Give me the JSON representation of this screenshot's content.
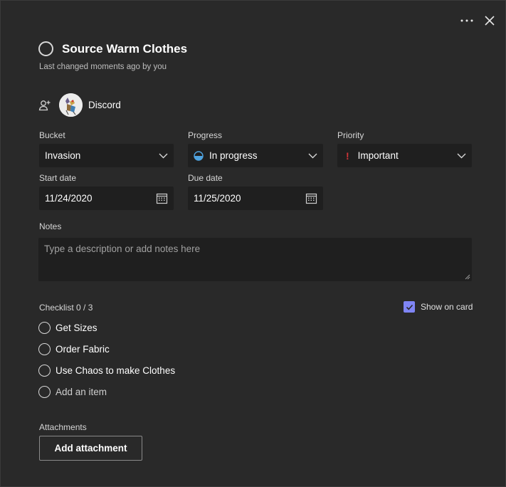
{
  "header": {
    "more_icon": "ellipsis-icon",
    "close_icon": "close-icon"
  },
  "task": {
    "title": "Source Warm Clothes",
    "last_changed": "Last changed moments ago by you"
  },
  "assignment": {
    "icon": "assign-person-icon",
    "assignee_name": "Discord"
  },
  "fields": {
    "bucket": {
      "label": "Bucket",
      "value": "Invasion"
    },
    "progress": {
      "label": "Progress",
      "value": "In progress",
      "color": "#4fa3e0"
    },
    "priority": {
      "label": "Priority",
      "value": "Important",
      "marker": "!",
      "color": "#d13438"
    },
    "start_date": {
      "label": "Start date",
      "value": "11/24/2020"
    },
    "due_date": {
      "label": "Due date",
      "value": "11/25/2020"
    }
  },
  "notes": {
    "label": "Notes",
    "placeholder": "Type a description or add notes here"
  },
  "checklist": {
    "label": "Checklist 0 / 3",
    "show_on_card_label": "Show on card",
    "show_on_card_checked": true,
    "accent": "#7f85f5",
    "items": [
      {
        "text": "Get Sizes"
      },
      {
        "text": "Order Fabric"
      },
      {
        "text": "Use Chaos to make Clothes"
      }
    ],
    "add_item_placeholder": "Add an item"
  },
  "attachments": {
    "label": "Attachments",
    "button_label": "Add attachment"
  }
}
